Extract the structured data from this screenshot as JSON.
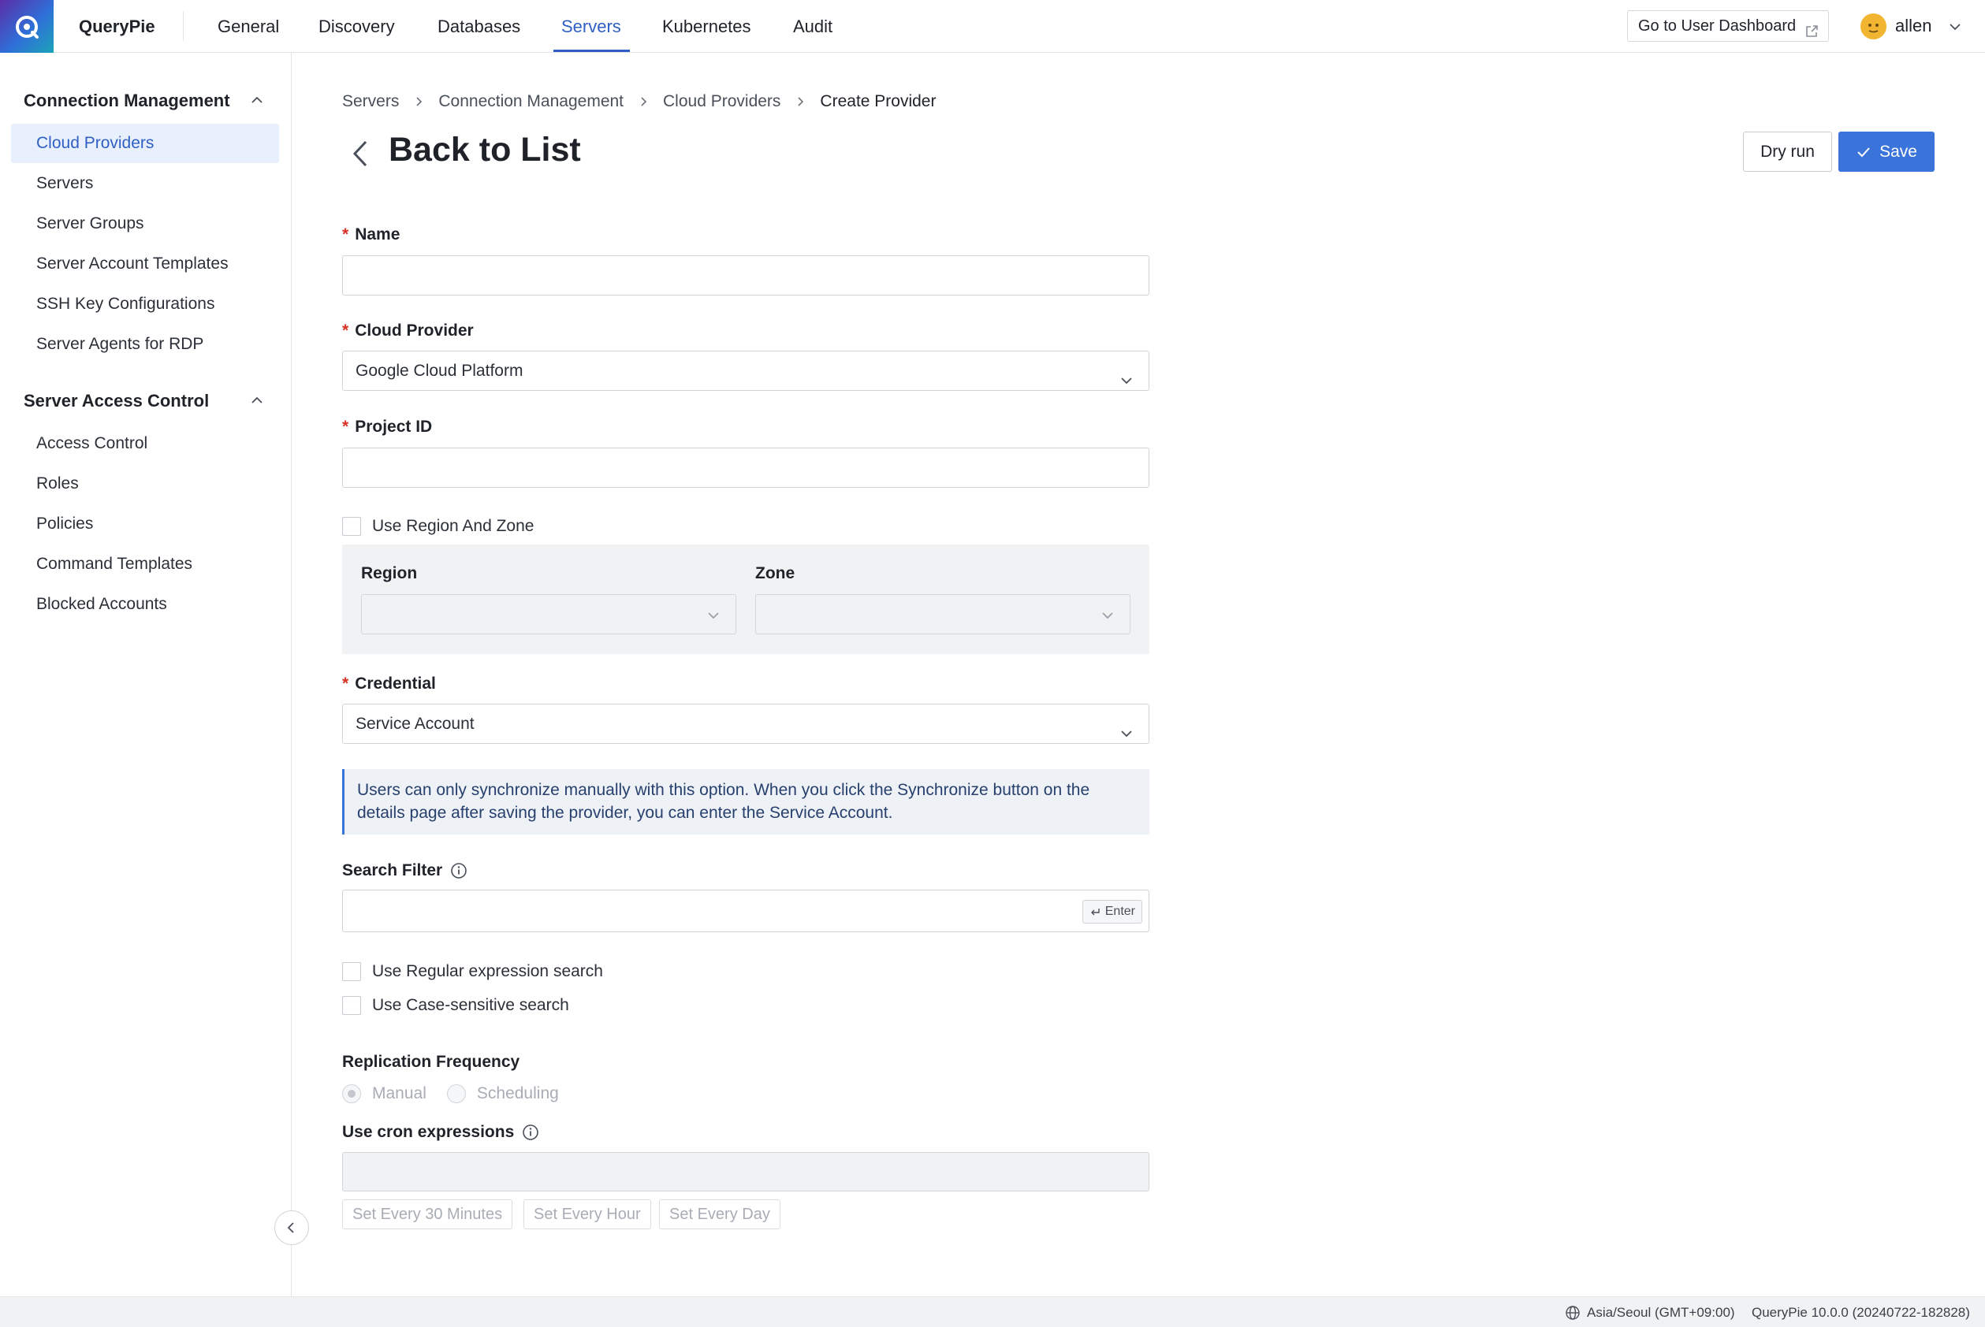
{
  "topbar": {
    "app_name": "QueryPie",
    "nav": [
      "General",
      "Discovery",
      "Databases",
      "Servers",
      "Kubernetes",
      "Audit"
    ],
    "active_nav": "Servers",
    "dashboard_button": "Go to User Dashboard",
    "user_name": "allen"
  },
  "sidebar": {
    "section1_title": "Connection Management",
    "section1_items": [
      "Cloud Providers",
      "Servers",
      "Server Groups",
      "Server Account Templates",
      "SSH Key Configurations",
      "Server Agents for RDP"
    ],
    "section1_active": "Cloud Providers",
    "section2_title": "Server Access Control",
    "section2_items": [
      "Access Control",
      "Roles",
      "Policies",
      "Command Templates",
      "Blocked Accounts"
    ]
  },
  "breadcrumb": [
    "Servers",
    "Connection Management",
    "Cloud Providers",
    "Create Provider"
  ],
  "header": {
    "title": "Back to List",
    "dry_run_label": "Dry run",
    "save_label": "Save"
  },
  "form": {
    "name_label": "Name",
    "name_value": "",
    "cloud_provider_label": "Cloud Provider",
    "cloud_provider_value": "Google Cloud Platform",
    "project_id_label": "Project ID",
    "project_id_value": "",
    "use_region_zone_label": "Use Region And Zone",
    "region_label": "Region",
    "zone_label": "Zone",
    "credential_label": "Credential",
    "credential_value": "Service Account",
    "info_text": "Users can only synchronize manually with this option. When you click the Synchronize button on the details page after saving the provider, you can enter the Service Account.",
    "search_filter_label": "Search Filter",
    "enter_hint": "Enter",
    "regex_label": "Use Regular expression search",
    "case_sensitive_label": "Use Case-sensitive search",
    "replication_label": "Replication Frequency",
    "radio_manual": "Manual",
    "radio_scheduling": "Scheduling",
    "cron_label": "Use cron expressions",
    "presets": [
      "Set Every 30 Minutes",
      "Set Every Hour",
      "Set Every Day"
    ]
  },
  "footer": {
    "timezone": "Asia/Seoul (GMT+09:00)",
    "version": "QueryPie 10.0.0 (20240722-182828)"
  },
  "colors": {
    "accent": "#3a73d9",
    "active_nav": "#2f5fc4",
    "required": "#d93026",
    "sidebar_active_bg": "#e9f0fd"
  }
}
